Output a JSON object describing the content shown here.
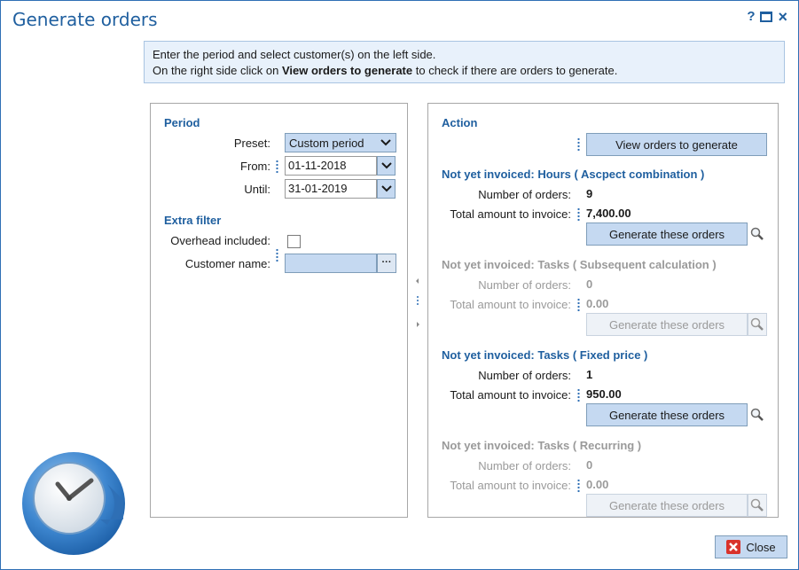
{
  "window": {
    "title": "Generate orders",
    "help_label": "?",
    "close_label": "×"
  },
  "info": {
    "line1": "Enter the period and select customer(s) on the left side.",
    "line2_prefix": "On the right side click on ",
    "line2_bold": "View orders to generate",
    "line2_suffix": " to check if there are orders to generate."
  },
  "period": {
    "title": "Period",
    "preset_label": "Preset:",
    "preset_value": "Custom period",
    "from_label": "From:",
    "from_value": "01-11-2018",
    "until_label": "Until:",
    "until_value": "31-01-2019"
  },
  "extra_filter": {
    "title": "Extra filter",
    "overhead_label": "Overhead included:",
    "customer_label": "Customer name:",
    "customer_value": "",
    "ellipsis_label": "···"
  },
  "action": {
    "title": "Action",
    "view_button": "View orders to generate"
  },
  "sections": [
    {
      "title": "Not yet invoiced: Hours ( Ascpect combination )",
      "orders_label": "Number of orders:",
      "orders_value": "9",
      "amount_label": "Total amount to invoice:",
      "amount_value": "7,400.00",
      "button_label": "Generate these orders",
      "enabled": true
    },
    {
      "title": "Not yet invoiced: Tasks ( Subsequent calculation )",
      "orders_label": "Number of orders:",
      "orders_value": "0",
      "amount_label": "Total amount to invoice:",
      "amount_value": "0.00",
      "button_label": "Generate these orders",
      "enabled": false
    },
    {
      "title": "Not yet invoiced: Tasks ( Fixed price )",
      "orders_label": "Number of orders:",
      "orders_value": "1",
      "amount_label": "Total amount to invoice:",
      "amount_value": "950.00",
      "button_label": "Generate these orders",
      "enabled": true
    },
    {
      "title": "Not yet invoiced: Tasks ( Recurring )",
      "orders_label": "Number of orders:",
      "orders_value": "0",
      "amount_label": "Total amount to invoice:",
      "amount_value": "0.00",
      "button_label": "Generate these orders",
      "enabled": false
    }
  ],
  "footer": {
    "close_button": "Close"
  },
  "colors": {
    "accent": "#1f5f9f",
    "button_bg": "#c5d9f1",
    "info_bg": "#e8f1fb",
    "disabled_text": "#9a9a9a"
  }
}
